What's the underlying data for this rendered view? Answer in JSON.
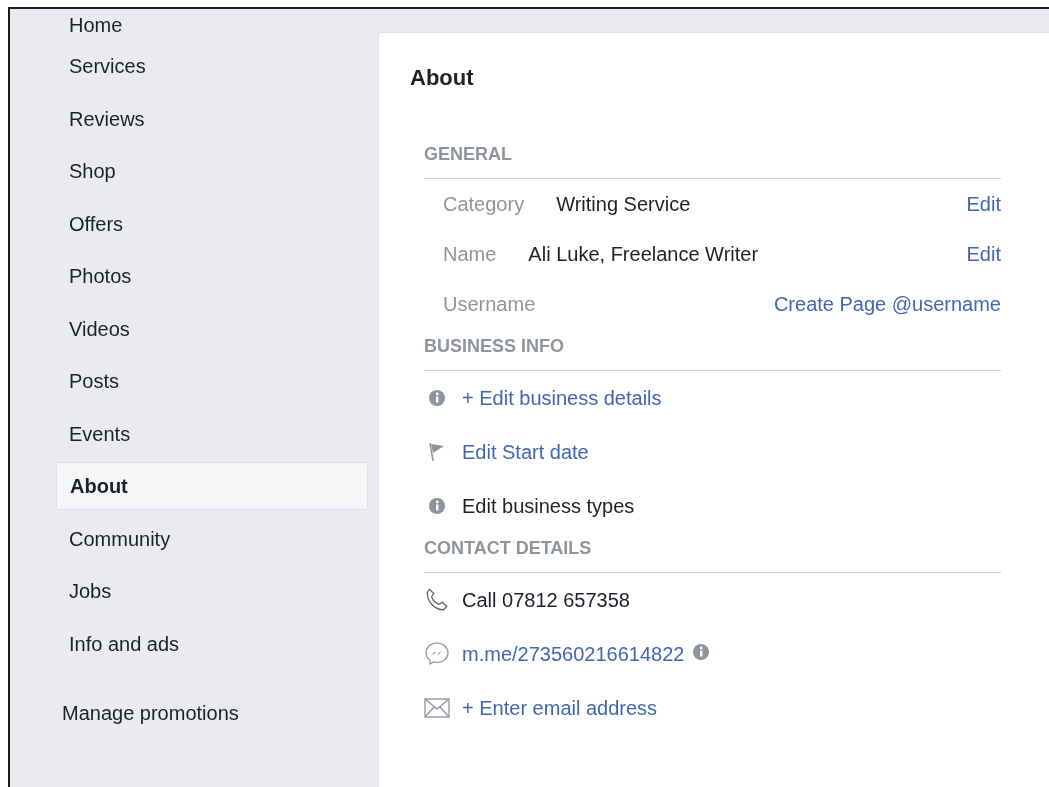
{
  "sidebar": {
    "items": [
      {
        "label": "Home",
        "selected": false
      },
      {
        "label": "Services",
        "selected": false
      },
      {
        "label": "Reviews",
        "selected": false
      },
      {
        "label": "Shop",
        "selected": false
      },
      {
        "label": "Offers",
        "selected": false
      },
      {
        "label": "Photos",
        "selected": false
      },
      {
        "label": "Videos",
        "selected": false
      },
      {
        "label": "Posts",
        "selected": false
      },
      {
        "label": "Events",
        "selected": false
      },
      {
        "label": "About",
        "selected": true
      },
      {
        "label": "Community",
        "selected": false
      },
      {
        "label": "Jobs",
        "selected": false
      },
      {
        "label": "Info and ads",
        "selected": false
      }
    ],
    "manage_promotions": "Manage promotions"
  },
  "about": {
    "title": "About",
    "general": {
      "heading": "GENERAL",
      "rows": [
        {
          "label": "Category",
          "value": "Writing Service",
          "action": "Edit"
        },
        {
          "label": "Name",
          "value": "Ali Luke, Freelance Writer",
          "action": "Edit"
        },
        {
          "label": "Username",
          "action": "Create Page @username"
        }
      ]
    },
    "business_info": {
      "heading": "BUSINESS INFO",
      "items": [
        {
          "kind": "info",
          "text": "+ Edit business details",
          "link": true
        },
        {
          "kind": "flag",
          "text": "Edit Start date",
          "link": true
        },
        {
          "kind": "info",
          "text": "Edit business types",
          "link": false
        }
      ]
    },
    "contact_details": {
      "heading": "CONTACT DETAILS",
      "items": [
        {
          "kind": "phone",
          "text": "Call 07812 657358",
          "link": false
        },
        {
          "kind": "messenger",
          "text": "m.me/273560216614822",
          "link": true,
          "info_badge": true
        },
        {
          "kind": "mail",
          "text": "+ Enter email address",
          "link": true
        }
      ]
    }
  }
}
